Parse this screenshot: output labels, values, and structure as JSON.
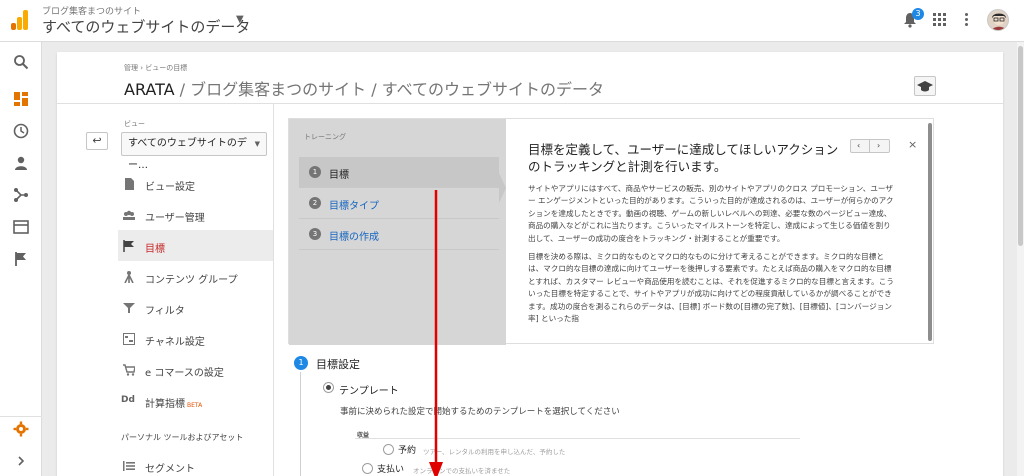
{
  "header": {
    "account_name": "ブログ集客まつのサイト",
    "property_view": "すべてのウェブサイトのデータ",
    "notification_count": "3"
  },
  "colors": {
    "brand_orange": "#f9ab00",
    "brand_orange_dark": "#e37400",
    "accent_blue": "#1e88e5",
    "active_red": "#c62828",
    "arrow_red": "#e00000"
  },
  "rail": {
    "icons": [
      "search-icon",
      "dashboard-icon",
      "clock-icon",
      "person-icon",
      "acquisition-icon",
      "behavior-icon",
      "flag-icon"
    ],
    "bottom_icons": [
      "settings-icon",
      "expand-icon"
    ]
  },
  "page": {
    "breadcrumb": "管理 › ビューの目標",
    "account": "ARATA",
    "path": " / ブログ集客まつのサイト / すべてのウェブサイトのデータ"
  },
  "view": {
    "label": "ビュー",
    "selected": "すべてのウェブサイトのデー…"
  },
  "nav": {
    "items": [
      {
        "label": "ビュー設定",
        "icon": "document-icon"
      },
      {
        "label": "ユーザー管理",
        "icon": "users-icon"
      },
      {
        "label": "目標",
        "icon": "flag-icon"
      },
      {
        "label": "コンテンツ グループ",
        "icon": "content-group-icon"
      },
      {
        "label": "フィルタ",
        "icon": "filter-icon"
      },
      {
        "label": "チャネル設定",
        "icon": "channel-icon"
      },
      {
        "label": "e コマースの設定",
        "icon": "cart-icon"
      },
      {
        "label": "計算指標",
        "icon": "dd-icon",
        "badge": "BETA"
      }
    ],
    "section_title": "パーソナル ツールおよびアセット",
    "section_items": [
      {
        "label": "セグメント",
        "icon": "segment-icon"
      }
    ]
  },
  "training": {
    "heading": "トレーニング",
    "steps": [
      {
        "num": "1",
        "label": "目標"
      },
      {
        "num": "2",
        "label": "目標タイプ"
      },
      {
        "num": "3",
        "label": "目標の作成"
      }
    ],
    "title": "目標を定義して、ユーザーに達成してほしいアクションのトラッキングと計測を行います。",
    "prev": "‹",
    "next": "›",
    "close": "×",
    "paragraphs": [
      "サイトやアプリにはすべて、商品やサービスの販売、別のサイトやアプリのクロス プロモーション、ユーザー エンゲージメントといった目的があります。こういった目的が達成されるのは、ユーザーが何らかのアクションを達成したときです。動画の視聴、ゲームの新しいレベルへの到達、必要な数のページビュー達成、商品の購入などがこれに当たります。こういったマイルストーンを特定し、達成によって生じる価値を割り出して、ユーザーの成功の度合をトラッキング・計測することが重要です。",
      "目標を決める際は、ミクロ的なものとマクロ的なものに分けて考えることができます。ミクロ的な目標とは、マクロ的な目標の達成に向けてユーザーを後押しする要素です。たとえば商品の購入をマクロ的な目標とすれば、カスタマー レビューや商品使用を読むことは、それを促進するミクロ的な目標と言えます。こういった目標を特定することで、サイトやアプリが成功に向けてどの程度貢献しているかが調べることができます。成功の度合を測るこれらのデータは、[目標] ボード数の[目標の完了数]、[目標値]、[コンバージョン率] といった指"
    ]
  },
  "setup": {
    "step_num": "1",
    "title": "目標設定",
    "template_label": "テンプレート",
    "template_desc": "事前に決められた設定で開始するためのテンプレートを選択してください",
    "group_label": "収益",
    "options": [
      {
        "label": "予約",
        "desc": "ツアー、レンタルの利用を申し込んだ、予約した"
      },
      {
        "label": "支払い",
        "desc": "オンラインでの支払いを済ませた"
      }
    ]
  }
}
